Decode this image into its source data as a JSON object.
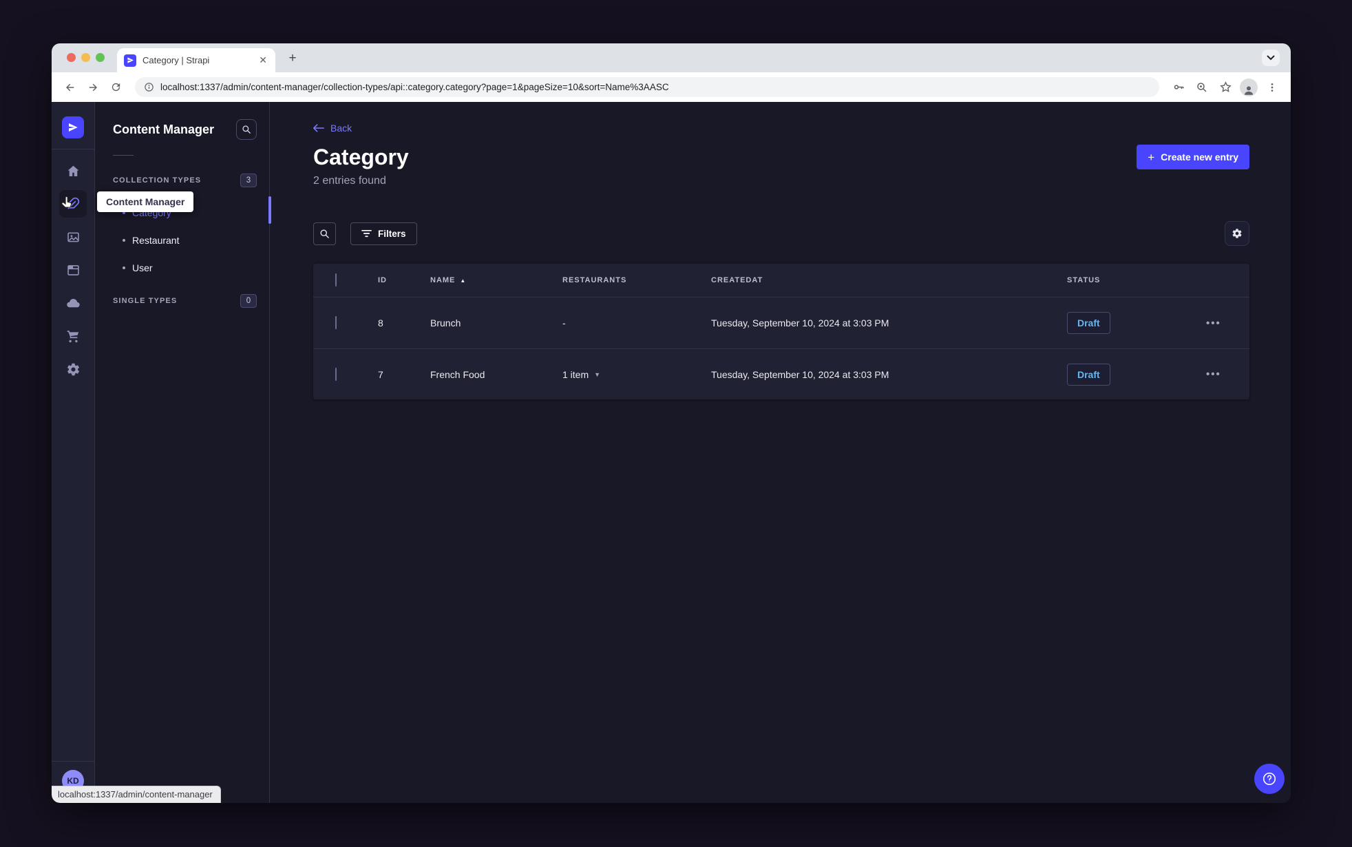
{
  "window": {
    "tab_title": "Category | Strapi",
    "url": "localhost:1337/admin/content-manager/collection-types/api::category.category?page=1&pageSize=10&sort=Name%3AASC",
    "status_link": "localhost:1337/admin/content-manager"
  },
  "nav": {
    "tooltip": "Content Manager",
    "avatar_initials": "KD",
    "icons": [
      "strapi-logo",
      "home",
      "content-manager",
      "media-library",
      "content-type-builder",
      "deploy-cloud",
      "marketplace",
      "settings"
    ]
  },
  "subnav": {
    "title": "Content Manager",
    "collection_types": {
      "label": "COLLECTION TYPES",
      "count": "3",
      "items": [
        {
          "label": "Category",
          "active": true
        },
        {
          "label": "Restaurant",
          "active": false
        },
        {
          "label": "User",
          "active": false
        }
      ]
    },
    "single_types": {
      "label": "SINGLE TYPES",
      "count": "0"
    }
  },
  "main": {
    "back": "Back",
    "title": "Category",
    "subtitle": "2 entries found",
    "create_button": "Create new entry",
    "filters": "Filters",
    "table": {
      "headers": {
        "id": "ID",
        "name": "NAME",
        "restaurants": "RESTAURANTS",
        "createdat": "CREATEDAT",
        "status": "STATUS"
      },
      "rows": [
        {
          "id": "8",
          "name": "Brunch",
          "restaurants": "-",
          "createdat": "Tuesday, September 10, 2024 at 3:03 PM",
          "status": "Draft"
        },
        {
          "id": "7",
          "name": "French Food",
          "restaurants": "1 item",
          "createdat": "Tuesday, September 10, 2024 at 3:03 PM",
          "status": "Draft"
        }
      ]
    }
  },
  "colors": {
    "accent": "#4945FF",
    "accent_light": "#7B79FF",
    "draft_text": "#66B7F1",
    "panel": "#212134",
    "background": "#181826"
  }
}
